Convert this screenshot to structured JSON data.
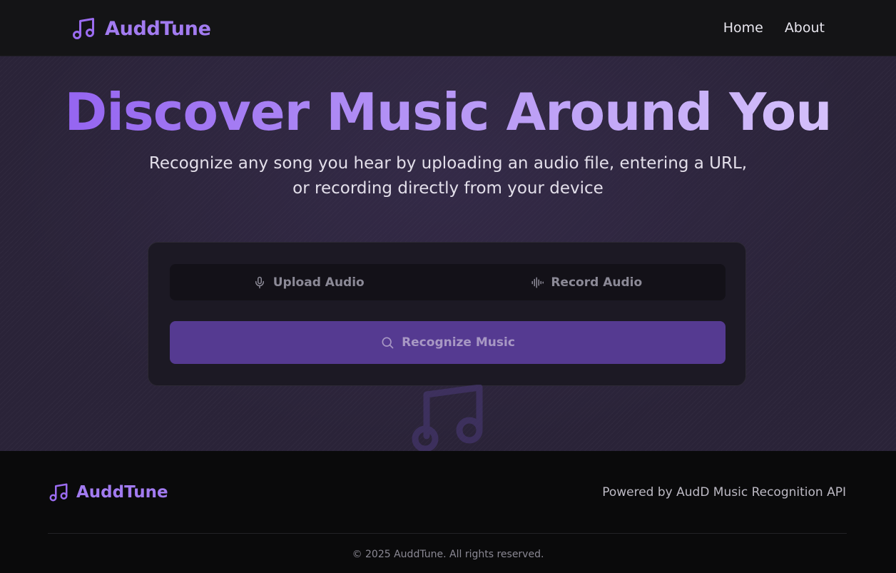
{
  "header": {
    "brand": "AuddTune",
    "brand_icon": "music-note-icon",
    "nav": [
      "Home",
      "About"
    ]
  },
  "hero": {
    "title": "Discover Music Around You",
    "subtitle": "Recognize any song you hear by uploading an audio file, entering a URL, or recording directly from your device"
  },
  "card": {
    "tabs": [
      {
        "label": "Upload Audio",
        "icon": "microphone-icon"
      },
      {
        "label": "Record Audio",
        "icon": "audio-waveform-icon"
      }
    ],
    "recognize_button": {
      "label": "Recognize Music",
      "icon": "search-icon"
    }
  },
  "footer": {
    "brand": "AuddTune",
    "powered_by": "Powered by AudD Music Recognition API",
    "copyright": "© 2025 AuddTune. All rights reserved."
  },
  "colors": {
    "accent": "#a27bf0",
    "button": "#553a91",
    "hero_bg": "#2a2338",
    "header_bg": "#141416",
    "footer_bg": "#0a0a0b"
  }
}
